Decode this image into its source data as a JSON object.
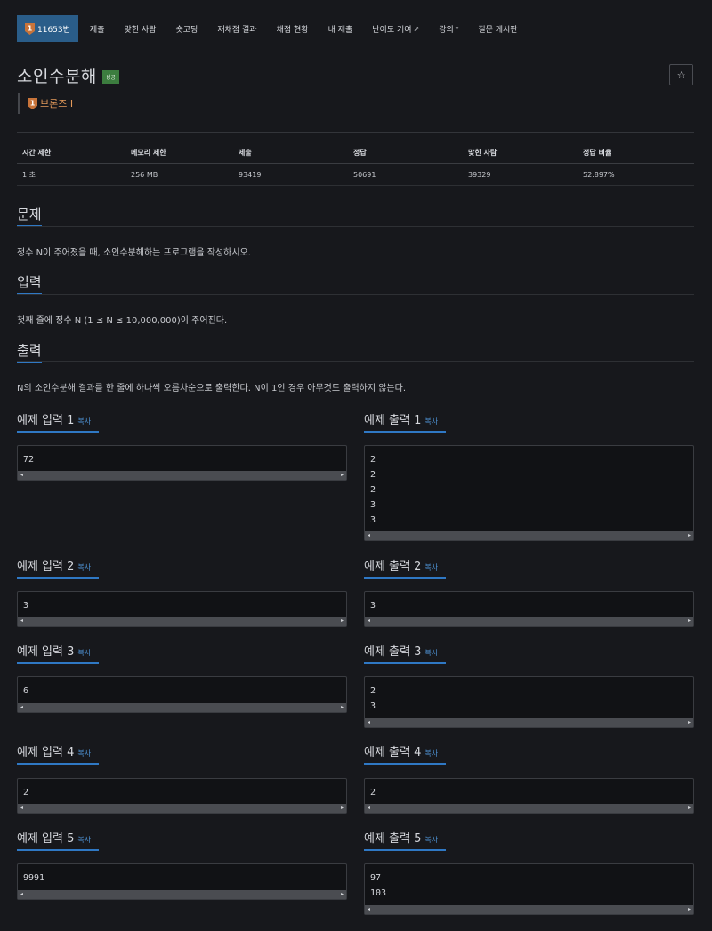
{
  "nav": {
    "problem_id": "11653번",
    "items": [
      "제출",
      "맞힌 사람",
      "숏코딩",
      "재채점 결과",
      "채점 현황",
      "내 제출",
      "난이도 기여",
      "강의",
      "질문 게시판"
    ]
  },
  "title": "소인수분해",
  "status_badge": "성공",
  "star": "☆",
  "tier": "브론즈 I",
  "stats": {
    "headers": [
      "시간 제한",
      "메모리 제한",
      "제출",
      "정답",
      "맞힌 사람",
      "정답 비율"
    ],
    "values": [
      "1 초",
      "256 MB",
      "93419",
      "50691",
      "39329",
      "52.897%"
    ]
  },
  "sections": {
    "problem": {
      "title": "문제",
      "text": "정수 N이 주어졌을 때, 소인수분해하는 프로그램을 작성하시오."
    },
    "input": {
      "title": "입력",
      "text": "첫째 줄에 정수 N (1 ≤ N ≤ 10,000,000)이 주어진다."
    },
    "output": {
      "title": "출력",
      "text": "N의 소인수분해 결과를 한 줄에 하나씩 오름차순으로 출력한다. N이 1인 경우 아무것도 출력하지 않는다."
    }
  },
  "copy_label": "복사",
  "examples": [
    {
      "in_title": "예제 입력 1",
      "out_title": "예제 출력 1",
      "input": "72",
      "output": "2\n2\n2\n3\n3"
    },
    {
      "in_title": "예제 입력 2",
      "out_title": "예제 출력 2",
      "input": "3",
      "output": "3"
    },
    {
      "in_title": "예제 입력 3",
      "out_title": "예제 출력 3",
      "input": "6",
      "output": "2\n3"
    },
    {
      "in_title": "예제 입력 4",
      "out_title": "예제 출력 4",
      "input": "2",
      "output": "2"
    },
    {
      "in_title": "예제 입력 5",
      "out_title": "예제 출력 5",
      "input": "9991",
      "output": "97\n103"
    }
  ],
  "colors": {
    "accent": "#2f78c4",
    "nav_active": "#2a5d89",
    "success": "#3c7d3f",
    "tier_bronze": "#e49a5a"
  }
}
